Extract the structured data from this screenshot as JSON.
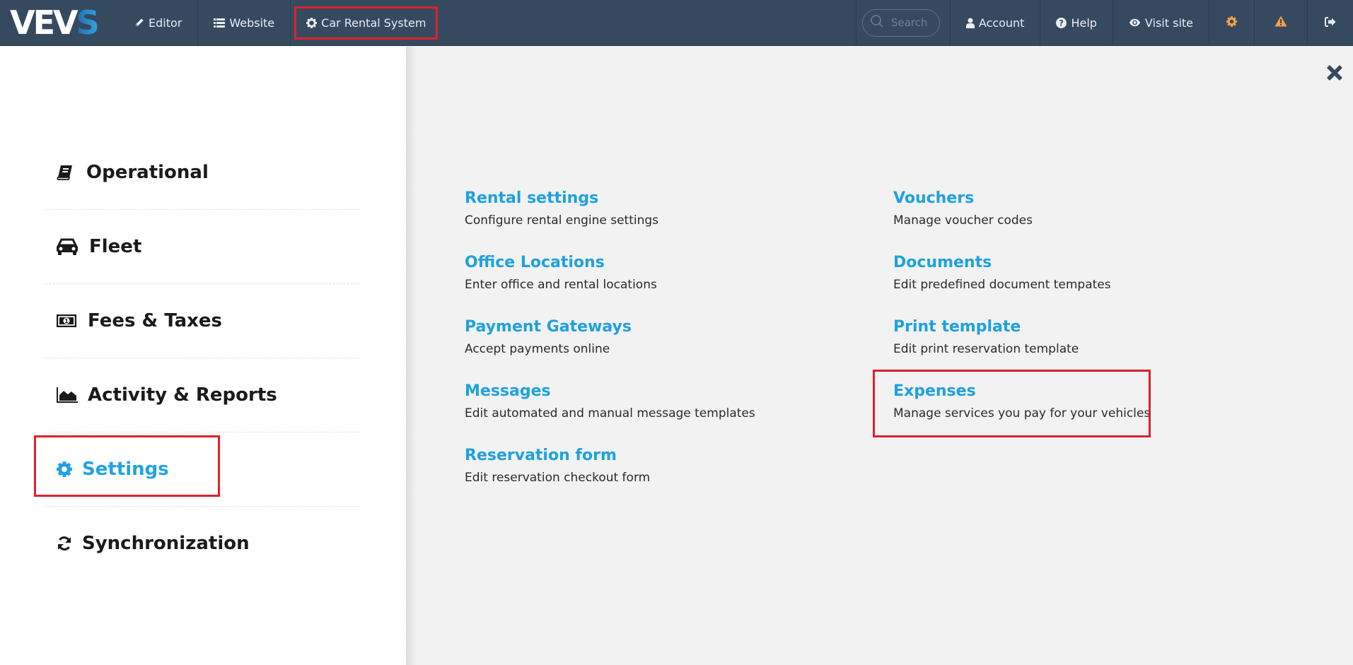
{
  "navbar": {
    "logo": {
      "text_main": "VEV",
      "text_accent": "S"
    },
    "items": [
      {
        "label": "Editor",
        "icon": "pencil-icon"
      },
      {
        "label": "Website",
        "icon": "list-icon"
      },
      {
        "label": "Car Rental System",
        "icon": "gear-icon",
        "highlighted": true
      }
    ],
    "search": {
      "placeholder": "Search",
      "value": ""
    },
    "right_items": [
      {
        "label": "Account",
        "icon": "user-icon"
      },
      {
        "label": "Help",
        "icon": "question-circle-icon"
      },
      {
        "label": "Visit site",
        "icon": "eye-icon"
      }
    ],
    "icon_buttons": [
      {
        "icon": "gear-icon",
        "color": "#f5a04a"
      },
      {
        "icon": "warning-icon",
        "color": "#f5a04a"
      },
      {
        "icon": "sign-out-icon",
        "color": "#e8eef4"
      }
    ],
    "colors": {
      "background": "#364a5f",
      "highlight_border": "#e0202a"
    }
  },
  "sidebar": {
    "items": [
      {
        "label": "Operational",
        "icon": "book-icon",
        "active": false
      },
      {
        "label": "Fleet",
        "icon": "car-icon",
        "active": false
      },
      {
        "label": "Fees & Taxes",
        "icon": "money-icon",
        "active": false
      },
      {
        "label": "Activity & Reports",
        "icon": "area-chart-icon",
        "active": false
      },
      {
        "label": "Settings",
        "icon": "gear-icon",
        "active": true,
        "highlighted": true
      },
      {
        "label": "Synchronization",
        "icon": "refresh-icon",
        "active": false
      }
    ],
    "active_color": "#21a3e0"
  },
  "main": {
    "close_icon": "close-icon",
    "left_column": [
      {
        "title": "Rental settings",
        "description": "Configure rental engine settings"
      },
      {
        "title": "Office Locations",
        "description": "Enter office and rental locations"
      },
      {
        "title": "Payment Gateways",
        "description": "Accept payments online"
      },
      {
        "title": "Messages",
        "description": "Edit automated and manual message templates"
      },
      {
        "title": "Reservation form",
        "description": "Edit reservation checkout form"
      }
    ],
    "right_column": [
      {
        "title": "Vouchers",
        "description": "Manage voucher codes"
      },
      {
        "title": "Documents",
        "description": "Edit predefined document tempates"
      },
      {
        "title": "Print template",
        "description": "Edit print reservation template"
      },
      {
        "title": "Expenses",
        "description": "Manage services you pay for your vehicles",
        "highlighted": true
      }
    ],
    "link_color": "#1ea1df"
  }
}
